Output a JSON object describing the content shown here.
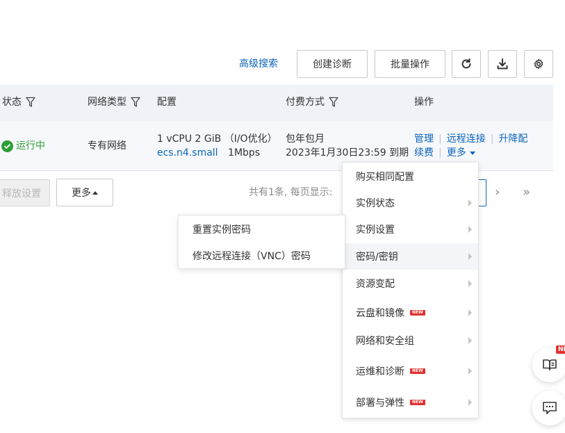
{
  "toolbar": {
    "advanced_search": "高级搜索",
    "create_diagnosis": "创建诊断",
    "batch_operation": "批量操作",
    "refresh_icon": "refresh-icon",
    "download_icon": "download-icon",
    "settings_icon": "gear-icon"
  },
  "table": {
    "headers": {
      "status": "状态",
      "network_type": "网络类型",
      "config": "配置",
      "payment": "付费方式",
      "operations": "操作"
    },
    "row": {
      "status": "运行中",
      "network_type": "专有网络",
      "config_line1": "1 vCPU 2 GiB （I/O优化）",
      "instance_type": "ecs.n4.small",
      "bandwidth": "1Mbps",
      "payment_type": "包年包月",
      "expiry": "2023年1月30日23:59 到期",
      "ops": {
        "manage": "管理",
        "remote_connect": "远程连接",
        "upgrade": "升降配",
        "renew": "续费",
        "more": "更多"
      }
    }
  },
  "footer": {
    "release_settings": "释放设置",
    "more": "更多",
    "pager_text": "共有1条, 每页显示:",
    "next": "›",
    "last": "»"
  },
  "dropdown": {
    "items": [
      {
        "label": "购买相同配置",
        "new": false,
        "arrow": false
      },
      {
        "label": "实例状态",
        "new": false,
        "arrow": true
      },
      {
        "label": "实例设置",
        "new": false,
        "arrow": true
      },
      {
        "label": "密码/密钥",
        "new": false,
        "arrow": true
      },
      {
        "label": "资源变配",
        "new": false,
        "arrow": true
      },
      {
        "label": "云盘和镜像",
        "new": true,
        "arrow": true
      },
      {
        "label": "网络和安全组",
        "new": false,
        "arrow": true
      },
      {
        "label": "运维和诊断",
        "new": true,
        "arrow": true
      },
      {
        "label": "部署与弹性",
        "new": true,
        "arrow": true
      }
    ],
    "new_badge": "NEW"
  },
  "submenu": {
    "items": [
      "重置实例密码",
      "修改远程连接（VNC）密码"
    ]
  },
  "floating": {
    "badge": "NE",
    "help_icon": "book-icon",
    "chat_icon": "chat-icon"
  },
  "colors": {
    "link": "#0b64b8",
    "running": "#2e9e36",
    "new_badge": "#e0322f",
    "header_bg": "#eff3f8"
  }
}
